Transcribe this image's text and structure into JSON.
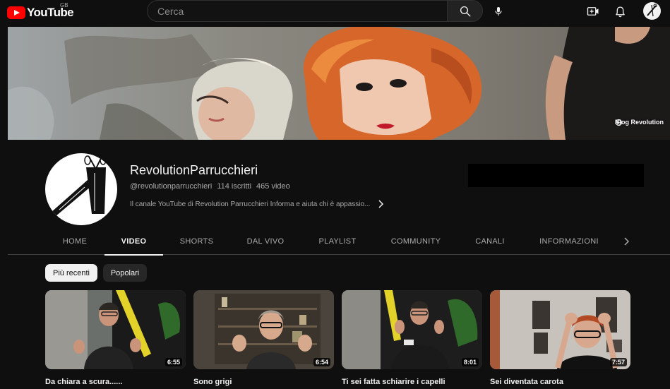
{
  "topbar": {
    "logo_text": "YouTube",
    "country_code": "GB",
    "search_placeholder": "Cerca",
    "icons": [
      "search-icon",
      "microphone-icon",
      "create-video-icon",
      "bell-icon"
    ]
  },
  "banner": {
    "link_label": "Blog Revolution"
  },
  "channel": {
    "name": "RevolutionParrucchieri",
    "handle": "@revolutionparrucchieri",
    "subscribers": "114 iscritti",
    "video_count": "465 video",
    "description": "Il canale YouTube di Revolution Parrucchieri Informa e aiuta chi è appassio..."
  },
  "tabs": [
    {
      "label": "HOME",
      "active": false
    },
    {
      "label": "VIDEO",
      "active": true
    },
    {
      "label": "SHORTS",
      "active": false
    },
    {
      "label": "DAL VIVO",
      "active": false
    },
    {
      "label": "PLAYLIST",
      "active": false
    },
    {
      "label": "COMMUNITY",
      "active": false
    },
    {
      "label": "CANALI",
      "active": false
    },
    {
      "label": "INFORMAZIONI",
      "active": false
    }
  ],
  "filters": [
    {
      "label": "Più recenti",
      "selected": true
    },
    {
      "label": "Popolari",
      "selected": false
    }
  ],
  "videos": [
    {
      "title": "Da chiara a scura......",
      "duration": "6:55"
    },
    {
      "title": "Sono grigi",
      "duration": "6:54"
    },
    {
      "title": "Ti sei fatta schiarire i capelli",
      "duration": "8:01"
    },
    {
      "title": "Sei diventata carota",
      "duration": "7:57"
    }
  ],
  "colors": {
    "background": "#0f0f0f",
    "brand_red": "#ff0000",
    "text_primary": "#f1f1f1",
    "text_secondary": "#aaaaaa"
  }
}
